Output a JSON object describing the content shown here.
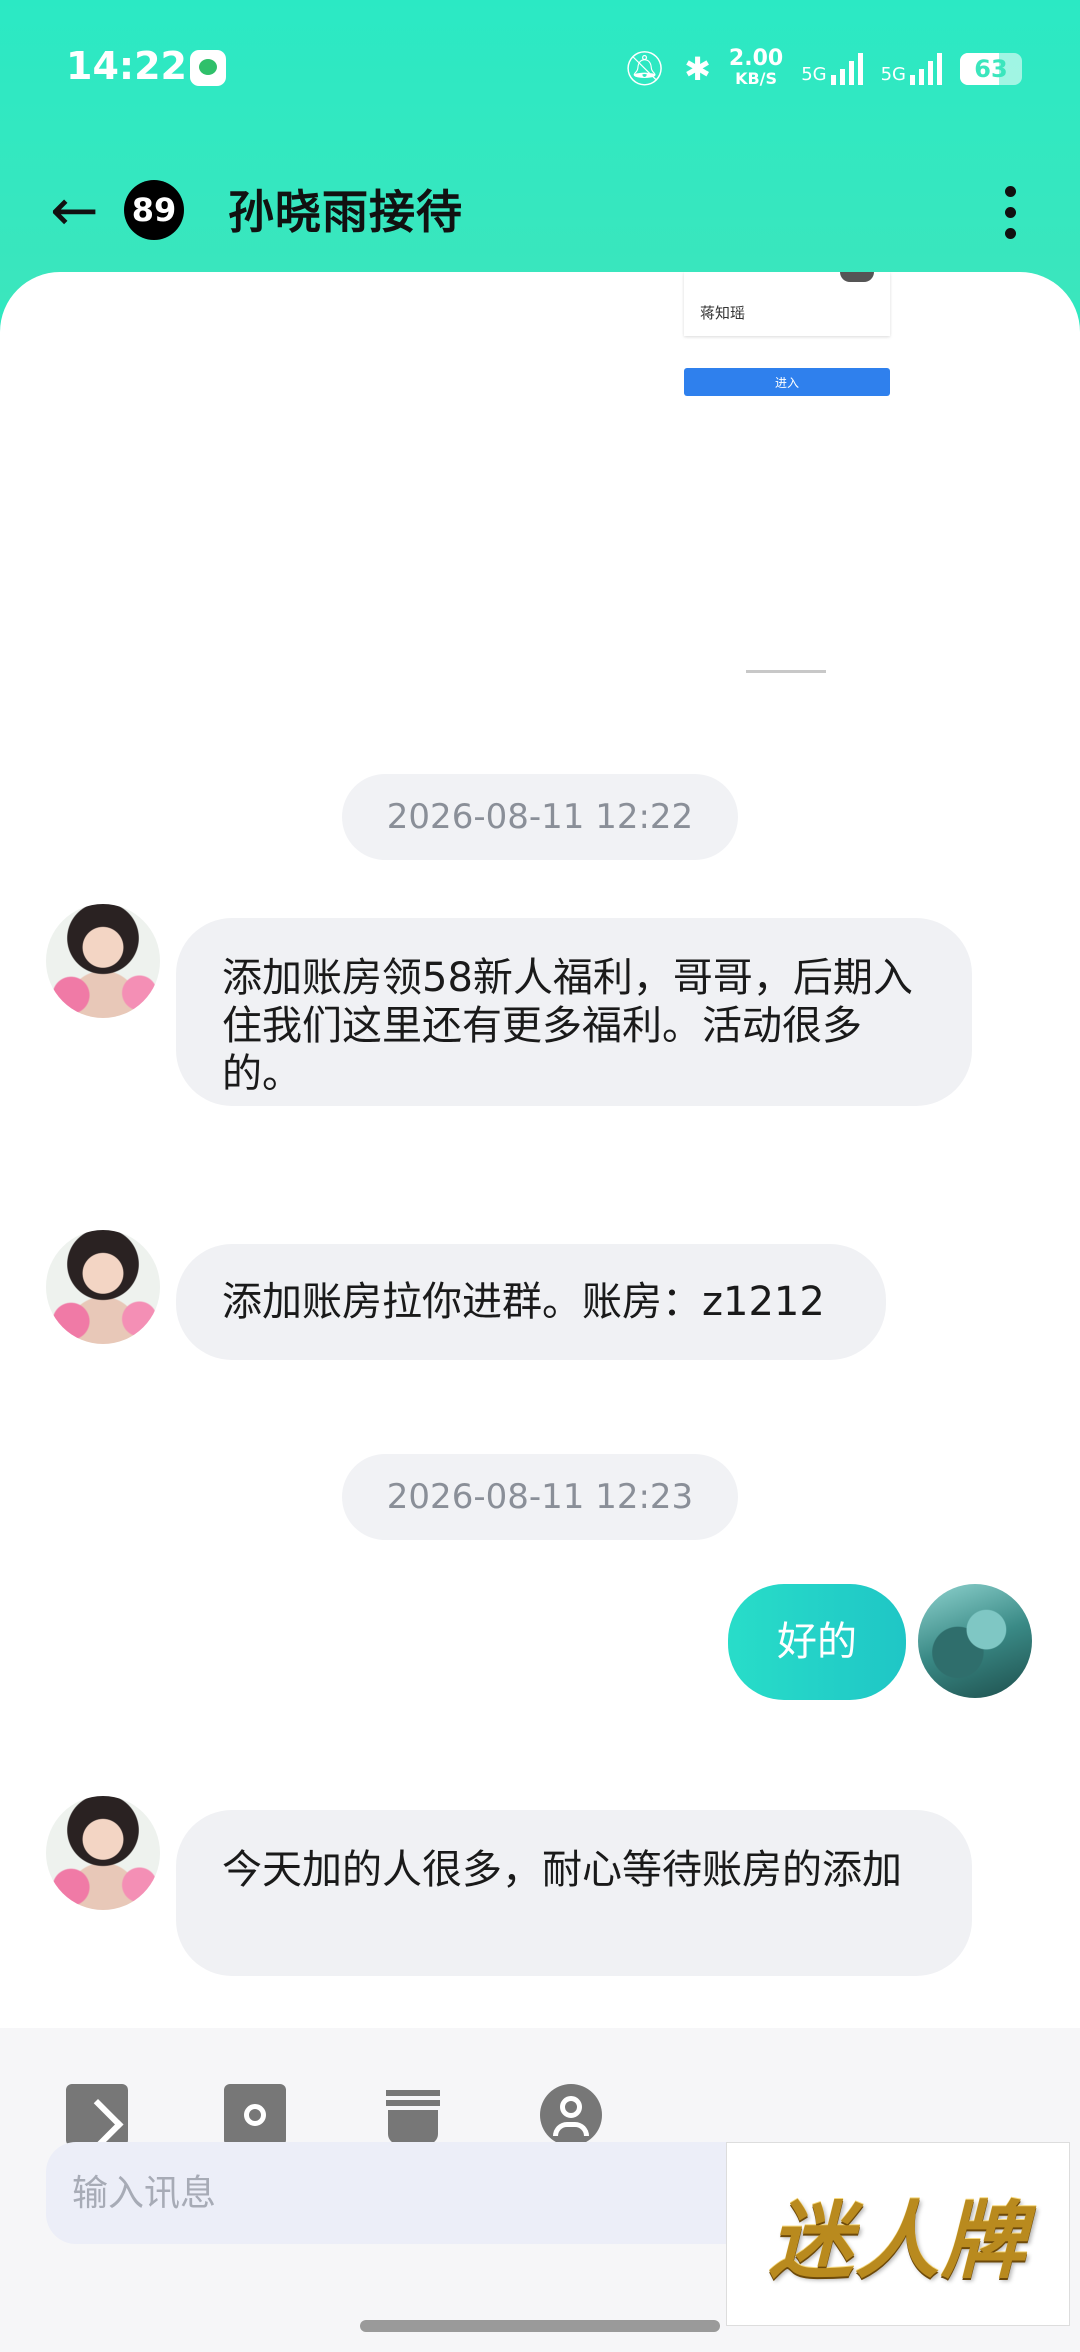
{
  "status_bar": {
    "time": "14:22",
    "net_speed_value": "2.00",
    "net_speed_unit": "KB/S",
    "sim1": "5G",
    "sim2": "5G",
    "battery": "63"
  },
  "header": {
    "back_icon": "arrow-left-icon",
    "unread_count": "89",
    "title": "孙晓雨接待",
    "more_icon": "more-vertical-icon"
  },
  "card_fragment": {
    "name": "蒋知瑶",
    "button": "进入"
  },
  "messages": [
    {
      "type": "timestamp",
      "text": "2026-08-11 12:22"
    },
    {
      "type": "incoming",
      "text": "添加账房领58新人福利，哥哥，后期入住我们这里还有更多福利。活动很多的。"
    },
    {
      "type": "incoming",
      "text": "添加账房拉你进群。账房：z1212"
    },
    {
      "type": "timestamp",
      "text": "2026-08-11 12:23"
    },
    {
      "type": "outgoing",
      "text": "好的"
    },
    {
      "type": "incoming",
      "text": "今天加的人很多，耐心等待账房的添加"
    }
  ],
  "composer": {
    "tools": [
      "image-icon",
      "camera-icon",
      "trash-icon",
      "contact-icon"
    ],
    "placeholder": "输入讯息"
  },
  "watermark_logo": "迷人牌",
  "colors": {
    "accent": "#2be9c4",
    "outgoing_bubble": "#1fc6c6",
    "incoming_bubble": "#f0f1f4"
  }
}
